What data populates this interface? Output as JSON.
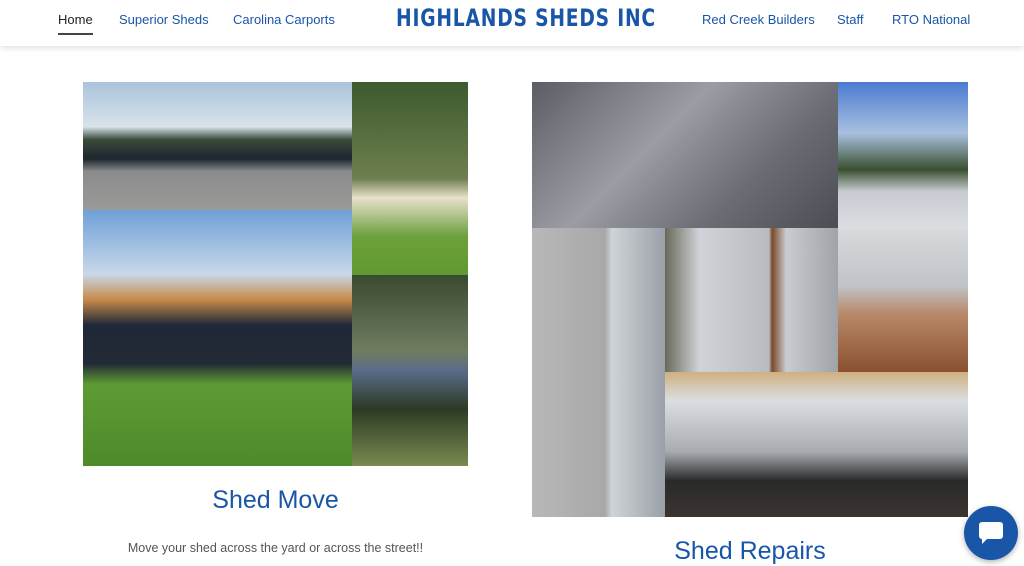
{
  "header": {
    "logo": "HIGHLANDS SHEDS INC",
    "nav_left": [
      "Home",
      "Superior Sheds",
      "Carolina Carports"
    ],
    "nav_right": [
      "Red Creek Builders",
      "Staff",
      "RTO National"
    ],
    "active": "Home"
  },
  "cards": [
    {
      "title": "Shed Move",
      "description": "Move your shed across the yard or across the street!!"
    },
    {
      "title": "Shed Repairs"
    }
  ],
  "colors": {
    "accent": "#1a56a8"
  },
  "chat": {
    "icon": "chat-bubble-icon"
  }
}
